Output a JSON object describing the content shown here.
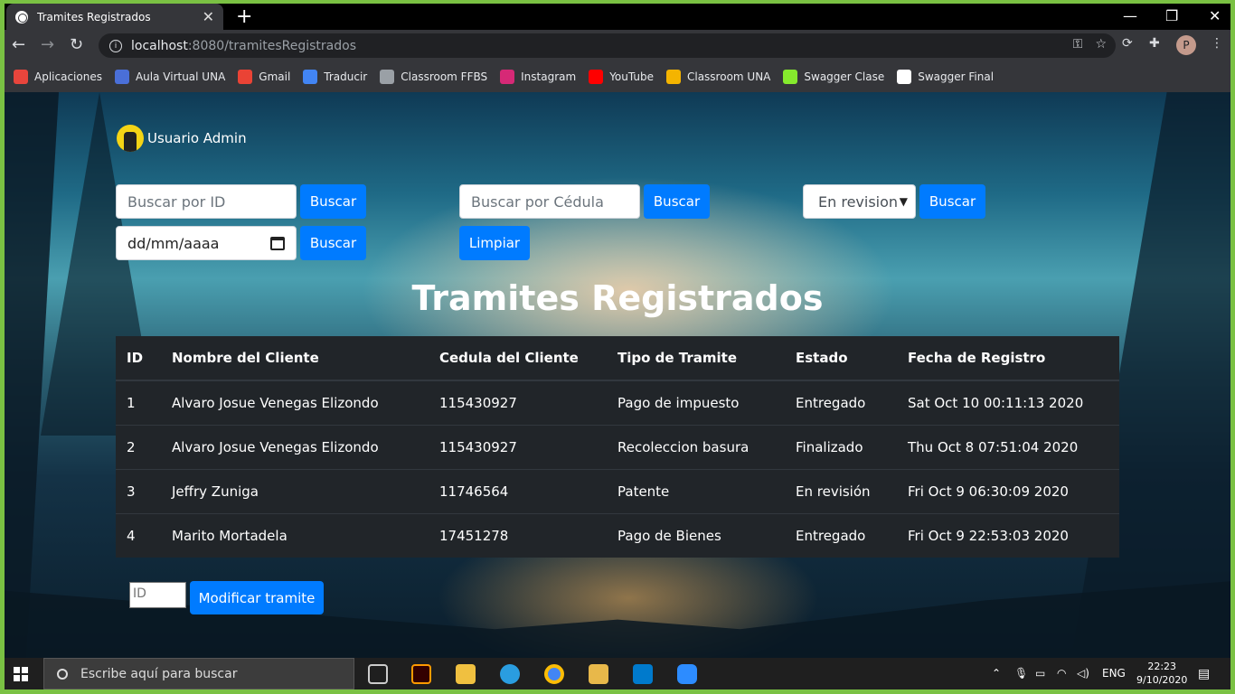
{
  "browser": {
    "tab_title": "Tramites Registrados",
    "tab_close": "✕",
    "new_tab": "+",
    "url_host": "localhost",
    "url_rest": ":8080/tramitesRegistrados",
    "window_controls": {
      "minimize": "—",
      "maximize": "❐",
      "close": "✕"
    },
    "profile_initial": "P",
    "bookmarks": [
      {
        "label": "Aplicaciones",
        "icon": "apps-grid-icon",
        "color": "#e8453c"
      },
      {
        "label": "Aula Virtual UNA",
        "icon": "aula-virtual-icon",
        "color": "#4a6fd8"
      },
      {
        "label": "Gmail",
        "icon": "gmail-icon",
        "color": "#ea4335"
      },
      {
        "label": "Traducir",
        "icon": "translate-icon",
        "color": "#4285f4"
      },
      {
        "label": "Classroom FFBS",
        "icon": "classroom-icon",
        "color": "#9aa0a6"
      },
      {
        "label": "Instagram",
        "icon": "instagram-icon",
        "color": "#d62976"
      },
      {
        "label": "YouTube",
        "icon": "youtube-icon",
        "color": "#ff0000"
      },
      {
        "label": "Classroom UNA",
        "icon": "classroom-icon",
        "color": "#f4b400"
      },
      {
        "label": "Swagger Clase",
        "icon": "swagger-icon",
        "color": "#85ea2d"
      },
      {
        "label": "Swagger Final",
        "icon": "globe-icon",
        "color": "#ffffff"
      }
    ]
  },
  "page": {
    "user_label": "Usuario Admin",
    "search_id": {
      "placeholder": "Buscar por ID",
      "button": "Buscar"
    },
    "search_date": {
      "placeholder": "dd/mm/aaaa",
      "button": "Buscar"
    },
    "search_cedula": {
      "placeholder": "Buscar por Cédula",
      "button": "Buscar"
    },
    "clear_button": "Limpiar",
    "status_filter": {
      "selected": "En revision",
      "button": "Buscar"
    },
    "title": "Tramites Registrados",
    "table": {
      "headers": [
        "ID",
        "Nombre del Cliente",
        "Cedula del Cliente",
        "Tipo de Tramite",
        "Estado",
        "Fecha de Registro"
      ],
      "rows": [
        [
          "1",
          "Alvaro Josue Venegas Elizondo",
          "115430927",
          "Pago de impuesto",
          "Entregado",
          "Sat Oct 10 00:11:13 2020"
        ],
        [
          "2",
          "Alvaro Josue Venegas Elizondo",
          "115430927",
          "Recoleccion basura",
          "Finalizado",
          "Thu Oct 8 07:51:04 2020"
        ],
        [
          "3",
          "Jeffry Zuniga",
          "11746564",
          "Patente",
          "En revisión",
          "Fri Oct 9 06:30:09 2020"
        ],
        [
          "4",
          "Marito Mortadela",
          "17451278",
          "Pago de Bienes",
          "Entregado",
          "Fri Oct 9 22:53:03 2020"
        ]
      ]
    },
    "modify": {
      "id_placeholder": "ID",
      "button": "Modificar tramite"
    }
  },
  "taskbar": {
    "search_placeholder": "Escribe aquí para buscar",
    "language": "ENG",
    "time": "22:23",
    "date": "9/10/2020"
  },
  "colors": {
    "primary_button": "#007bff",
    "table_bg": "#212529",
    "page_accent_border": "#7ac143"
  }
}
